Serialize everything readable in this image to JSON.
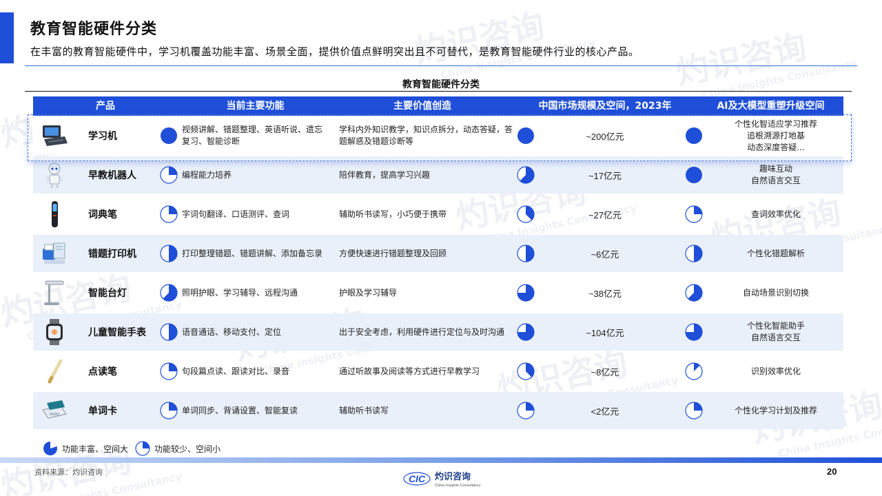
{
  "header": {
    "title": "教育智能硬件分类",
    "subtitle": "在丰富的教育智能硬件中，学习机覆盖功能丰富、场景全面，提供价值点鲜明突出且不可替代，是教育智能硬件行业的核心产品。"
  },
  "table": {
    "title": "教育智能硬件分类",
    "columns": [
      "产品",
      "当前主要功能",
      "主要价值创造",
      "中国市场规模及空间，2023年",
      "AI及大模型重塑升级空间"
    ],
    "rows": [
      {
        "name": "学习机",
        "icon": "tablet-keyboard-icon",
        "func": "视频讲解、错题整理、英语听说、遗忘复习、智能诊断",
        "func_level": 1.0,
        "value": "学科内外知识教学，知识点拆分，动态答疑，答题解惑及错题诊断等",
        "value_level": 1.0,
        "size": "~200亿元",
        "ai": "个性化智适应学习推荐\n追根溯源打地基\n动态深度答疑...",
        "ai_level": 1.0
      },
      {
        "name": "早教机器人",
        "icon": "robot-icon",
        "func": "编程能力培养",
        "func_level": 0.25,
        "value": "陪伴教育，提高学习兴趣",
        "value_level": 0.625,
        "size": "~17亿元",
        "ai": "趣味互动\n自然语言交互",
        "ai_level": 1.0
      },
      {
        "name": "词典笔",
        "icon": "dictionary-pen-icon",
        "func": "字词句翻译、口语测评、查词",
        "func_level": 0.25,
        "value": "辅助听书读写，小巧便于携带",
        "value_level": 0.375,
        "size": "~27亿元",
        "ai": "查词效率优化",
        "ai_level": 0.25
      },
      {
        "name": "错题打印机",
        "icon": "printer-icon",
        "func": "打印整理错题、错题讲解、添加备忘录",
        "func_level": 0.5,
        "value": "方便快速进行错题整理及回顾",
        "value_level": 0.5,
        "size": "~6亿元",
        "ai": "个性化错题解析",
        "ai_level": 0.5
      },
      {
        "name": "智能台灯",
        "icon": "desk-lamp-icon",
        "func": "照明护眼、学习辅导、远程沟通",
        "func_level": 0.625,
        "value": "护眼及学习辅导",
        "value_level": 0.75,
        "size": "~38亿元",
        "ai": "自动场景识别切换",
        "ai_level": 0.625
      },
      {
        "name": "儿童智能手表",
        "icon": "smartwatch-icon",
        "func": "语音通话、移动支付、定位",
        "func_level": 0.5,
        "value": "出于安全考虑，利用硬件进行定位与及时沟通",
        "value_level": 0.75,
        "size": "~104亿元",
        "ai": "个性化智能助手\n自然语言交互",
        "ai_level": 0.75
      },
      {
        "name": "点读笔",
        "icon": "reading-pen-icon",
        "func": "句段篇点读、跟读对比、录音",
        "func_level": 0.25,
        "value": "通过听故事及阅读等方式进行早教学习",
        "value_level": 0.375,
        "size": "~8亿元",
        "ai": "识别效率优化",
        "ai_level": 0.125
      },
      {
        "name": "单词卡",
        "icon": "word-card-icon",
        "func": "单词同步、背诵设置、智能复读",
        "func_level": 0.25,
        "value": "辅助听书读写",
        "value_level": 0.25,
        "size": "<2亿元",
        "ai": "个性化学习计划及推荐",
        "ai_level": 0.25
      }
    ]
  },
  "legend": {
    "rich": "功能丰富、空间大",
    "less": "功能较少、空间小"
  },
  "footer": {
    "source": "资料来源：灼识咨询",
    "logo_mark": "CIC",
    "logo_name": "灼识咨询",
    "logo_en": "China Insights Consultancy",
    "page": "20"
  },
  "watermark": {
    "cn": "灼识咨询",
    "en": "China Insights Consultancy"
  },
  "colors": {
    "accent": "#1f4fd8",
    "row_shade": "#eaf0f9"
  }
}
